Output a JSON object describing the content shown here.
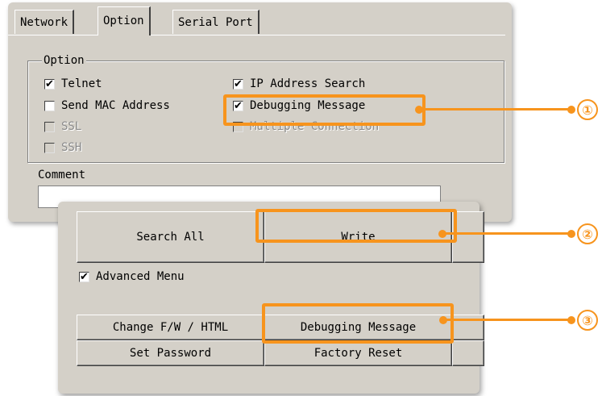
{
  "tabs": [
    "Network",
    "Option",
    "Serial Port"
  ],
  "option_group": {
    "title": "Option",
    "checkboxes": [
      {
        "label": "Telnet",
        "checked": true,
        "enabled": true
      },
      {
        "label": "Send MAC Address",
        "checked": false,
        "enabled": true
      },
      {
        "label": "SSL",
        "checked": false,
        "enabled": false
      },
      {
        "label": "SSH",
        "checked": false,
        "enabled": false
      },
      {
        "label": "IP Address Search",
        "checked": true,
        "enabled": true
      },
      {
        "label": "Debugging Message",
        "checked": true,
        "enabled": true
      },
      {
        "label": "Multiple Connection",
        "checked": false,
        "enabled": false
      }
    ],
    "check_mark": "✔"
  },
  "comment": {
    "label": "Comment",
    "value": ""
  },
  "buttons": {
    "search_all": "Search All",
    "write": "Write",
    "advanced_menu": "Advanced Menu",
    "change_fw": "Change F/W / HTML",
    "debugging_message": "Debugging Message",
    "set_password": "Set Password",
    "factory_reset": "Factory Reset"
  },
  "callouts": [
    "①",
    "②",
    "③"
  ],
  "accent_color": "#f7941d"
}
